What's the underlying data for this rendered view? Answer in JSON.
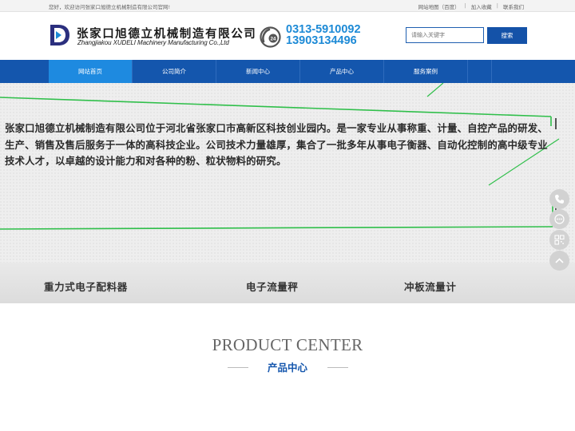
{
  "topbar": {
    "welcome": "您好，欢迎访问张家口旭德立机械制造有限公司官网!",
    "links": [
      "网站地图（百度）",
      "加入收藏",
      "联系我们"
    ]
  },
  "header": {
    "company_cn": "张家口旭德立机械制造有限公司",
    "company_en": "Zhangjiakou XUDELI Machinery Manufacturing Co.,Ltd",
    "phone_icon_text": "24",
    "phone1": "0313-5910092",
    "phone2": "13903134496",
    "search_placeholder": "请输入关键字",
    "search_button": "搜索"
  },
  "nav": {
    "items": [
      "网站首页",
      "公司简介",
      "新闻中心",
      "产品中心",
      "服务案例"
    ],
    "active": "网站首页"
  },
  "banner": {
    "text": "张家口旭德立机械制造有限公司位于河北省张家口市高新区科技创业园内。是一家专业从事称重、计量、自控产品的研发、生产、销售及售后服务于一体的高科技企业。公司技术力量雄厚，集合了一批多年从事电子衡器、自动化控制的高中级专业技术人才，以卓越的设计能力和对各种的粉、粒状物料的研究。",
    "products": [
      "重力式电子配料器",
      "电子流量秤",
      "冲板流量计"
    ]
  },
  "side_buttons": [
    "phone-icon",
    "chat-icon",
    "qrcode-icon",
    "back-to-top-icon"
  ],
  "product_center": {
    "title_en": "PRODUCT CENTER",
    "title_cn": "产品中心"
  },
  "colors": {
    "nav_bg": "#1456ad",
    "nav_active": "#1e8ae0",
    "phone_blue": "#1d8ad6",
    "accent_green": "#2fbf4a"
  }
}
